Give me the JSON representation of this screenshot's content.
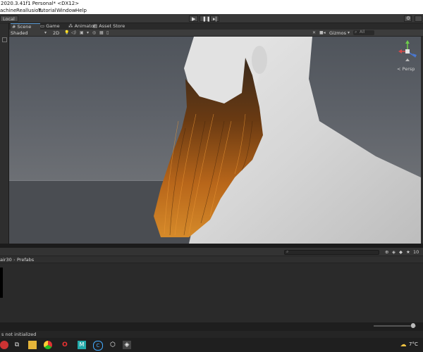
{
  "window": {
    "title": "2020.3.41f1 Personal* <DX12>"
  },
  "menu": {
    "items": [
      "achine",
      "Reallusion",
      "Tutorial",
      "Window",
      "Help"
    ]
  },
  "toolbar": {
    "pivot_label": "Local"
  },
  "scene_tabs": [
    {
      "label": "Scene",
      "active": true
    },
    {
      "label": "Game",
      "active": false
    },
    {
      "label": "Animator",
      "active": false
    },
    {
      "label": "Asset Store",
      "active": false
    }
  ],
  "scene_toolbar": {
    "shading": "Shaded",
    "mode_2d": "2D",
    "gizmos": "Gizmos",
    "search_all": "All"
  },
  "viewport": {
    "persp_label": "< Persp"
  },
  "project": {
    "breadcrumb": [
      "air30",
      "Prefabs"
    ],
    "count_label": "10"
  },
  "status": {
    "message": "s not initialized"
  },
  "taskbar": {
    "temperature": "7°C"
  },
  "colors": {
    "accent": "#5b9bd5",
    "editor_bg": "#383838",
    "hair": "#b8661a"
  }
}
